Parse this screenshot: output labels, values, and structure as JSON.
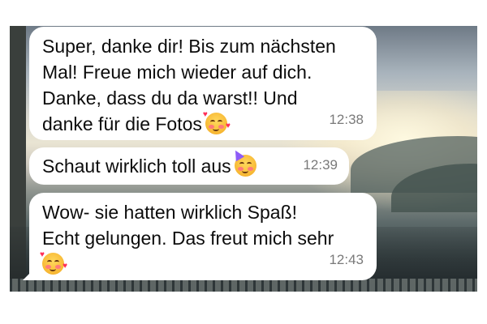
{
  "messages": [
    {
      "text": "Super, danke dir! Bis zum nächsten\nMal! Freue mich wieder auf dich.\nDanke, dass du da warst!! Und\ndanke für die Fotos",
      "emoji": "smiling-face-with-hearts",
      "time": "12:38"
    },
    {
      "text": "Schaut wirklich toll aus",
      "emoji": "partying-face",
      "time": "12:39"
    },
    {
      "text": "Wow- sie hatten wirklich Spaß!\nEcht gelungen. Das freut mich sehr",
      "emoji": "smiling-face-with-hearts",
      "time": "12:43"
    }
  ],
  "colors": {
    "bubble": "#ffffff",
    "time": "#7a7a7a",
    "text": "#0c0c0c"
  }
}
